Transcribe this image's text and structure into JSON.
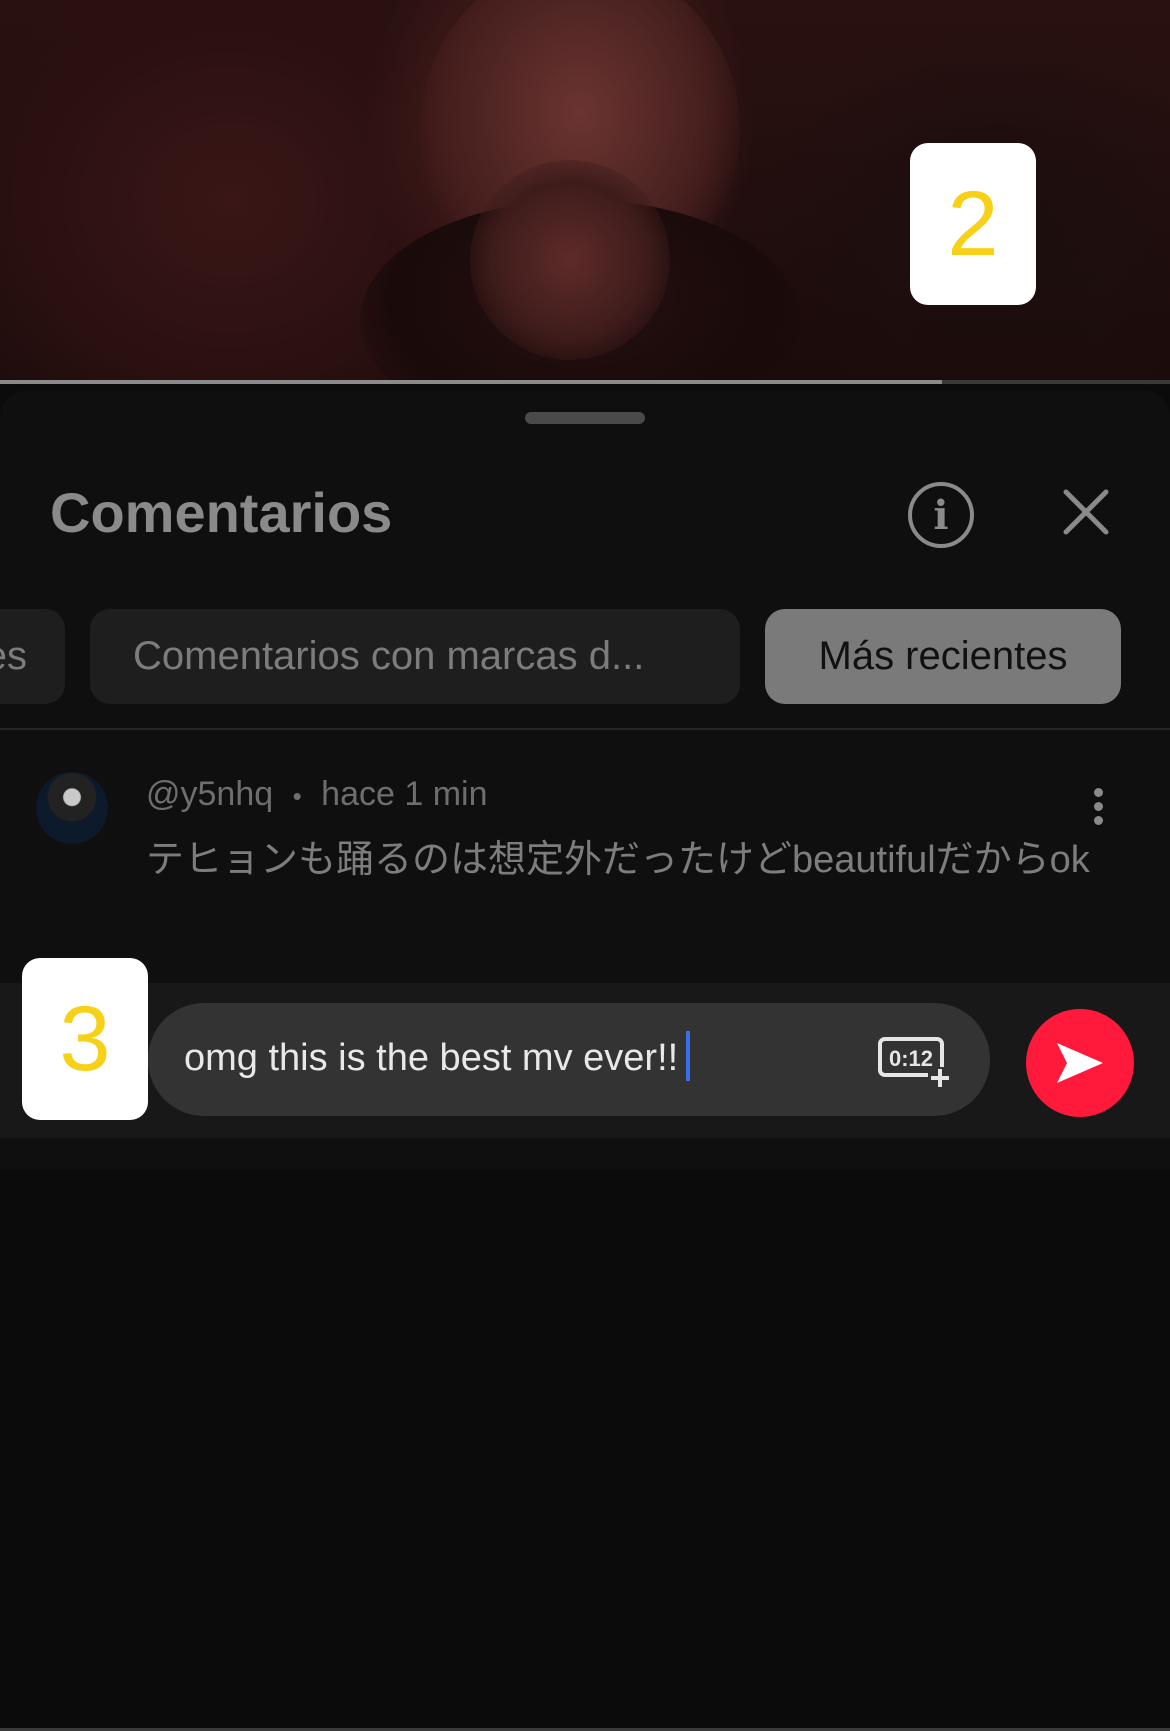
{
  "video": {
    "progress": 0.805
  },
  "markers": {
    "top": "2",
    "bottom": "3"
  },
  "comments_panel": {
    "title": "Comentarios",
    "info_icon": "info-icon",
    "close_icon": "close-icon",
    "filter_chips": [
      {
        "label": "es",
        "active": false
      },
      {
        "label": "Comentarios con marcas d...",
        "active": false
      },
      {
        "label": "Más recientes",
        "active": true
      }
    ],
    "comment": {
      "username": "@y5nhq",
      "separator": "•",
      "time": "hace 1 min",
      "text": "テヒョンも踊るのは想定外だったけどbeautifulだからok",
      "menu_icon": "more-vertical-icon"
    },
    "composer": {
      "value": "omg this is the best mv ever!!",
      "timestamp_label": "0:12",
      "timestamp_icon": "add-timestamp-icon",
      "send_icon": "send-icon",
      "send_color": "#ff1a3c"
    }
  }
}
